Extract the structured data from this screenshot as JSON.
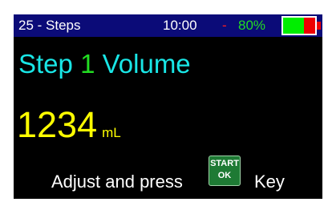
{
  "status_bar": {
    "mode_label": "25 - Steps",
    "clock": "10:00",
    "separator": "-",
    "battery_percent_text": "80%",
    "battery_level": 0.8,
    "colors": {
      "background": "#0b0b78",
      "separator": "#ff2020",
      "battery_text": "#22dd22",
      "battery_fill": "#00ee00",
      "battery_empty": "#ee0000"
    }
  },
  "main": {
    "title_prefix": "Step",
    "step_number": "1",
    "title_suffix": "Volume",
    "volume_value": "1234",
    "volume_unit": "mL",
    "colors": {
      "title": "#19e6e6",
      "step_number": "#22dd22",
      "volume": "#ffff00"
    }
  },
  "instruction": {
    "text_before": "Adjust and press",
    "key_icon": "start-ok-key-icon",
    "key_label_top": "START",
    "key_label_bottom": "OK",
    "text_after": "Key"
  }
}
